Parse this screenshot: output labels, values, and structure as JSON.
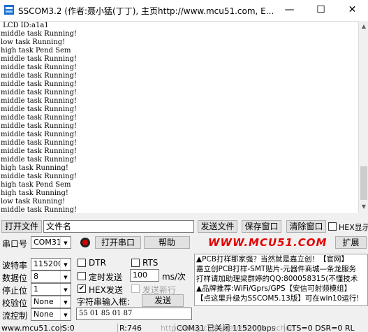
{
  "window": {
    "title": "SSCOM3.2 (作者:聂小猛(丁丁), 主页http://www.mcu51.com,  E...",
    "minimize": "—",
    "maximize": "☐",
    "close": "✕"
  },
  "receive": {
    "lines": [
      " LCD ID:a1a1",
      "middle task Running!",
      "low task Running!",
      "high task Pend Sem",
      "middle task Running!",
      "middle task Running!",
      "middle task Running!",
      "middle task Running!",
      "middle task Running!",
      "middle task Running!",
      "middle task Running!",
      "middle task Running!",
      "middle task Running!",
      "middle task Running!",
      "middle task Running!",
      "middle task Running!",
      "middle task Running!",
      "high task Running!",
      "middle task Running!",
      "high task Pend Sem",
      "high task Running!",
      "low task Running!",
      "middle task Running!"
    ]
  },
  "row1": {
    "open_file": "打开文件",
    "file_name": "文件名",
    "send_file": "发送文件",
    "save_window": "保存窗口",
    "clear_window": "清除窗口",
    "hex_display": "HEX显示"
  },
  "row2": {
    "port_label": "串口号",
    "port_value": "COM31",
    "open_port": "打开串口",
    "help": "帮助",
    "website": "WWW.MCU51.COM",
    "expand": "扩展"
  },
  "settings": {
    "baud_label": "波特率",
    "baud_value": "115200",
    "databits_label": "数据位",
    "databits_value": "8",
    "stopbits_label": "停止位",
    "stopbits_value": "1",
    "parity_label": "校验位",
    "parity_value": "None",
    "flow_label": "流控制",
    "flow_value": "None"
  },
  "options": {
    "dtr": "DTR",
    "rts": "RTS",
    "timed_send": "定时发送",
    "interval": "100",
    "interval_unit": "ms/次",
    "hex_send": "HEX发送",
    "send_newline": "发送新行",
    "input_label": "字符串输入框:",
    "send": "发送",
    "send_text": "55 01 85 01 87"
  },
  "ads": [
    "▲PCB打样那家强？当然就是嘉立创！【官网】",
    "嘉立创PCB打样-SMT贴片-元器件商城—条龙服务",
    "打样请加助理梁群婷的QQ:800058315(不懂技术",
    "▲品牌推荐:WiFi/Gprs/GPS【安信可射频模组】",
    "【点这里升级为SSCOM5.13版】可在win10运行!"
  ],
  "statusbar": {
    "site": "www.mcu51.cor",
    "sent": "S:0",
    "received": "R:746",
    "port_status": "COM31 已关闭  115200bps",
    "signals": "CTS=0 DSR=0 RL"
  },
  "watermark": "http://blog.csdn.net/zhangxuechao_"
}
